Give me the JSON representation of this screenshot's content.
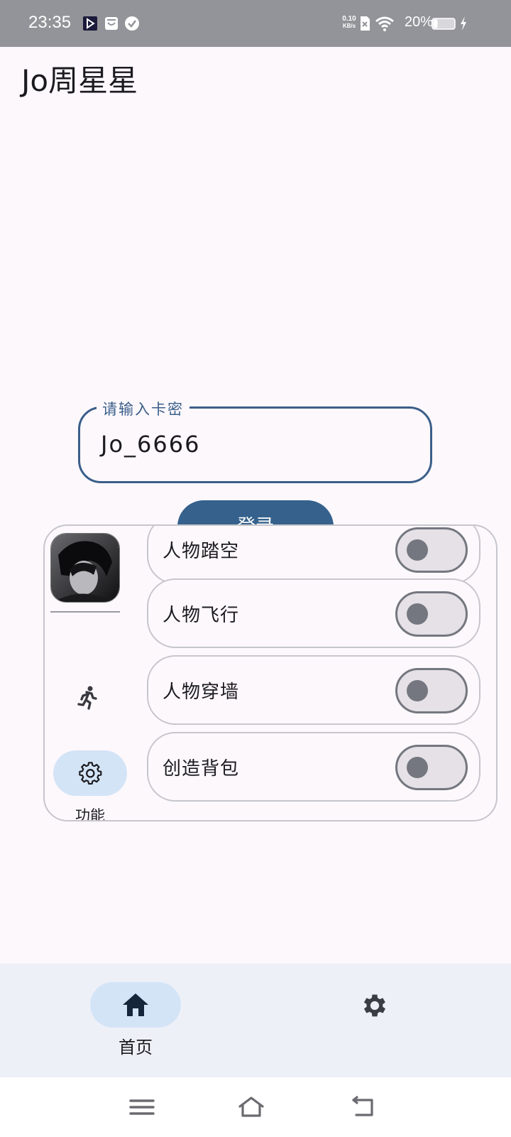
{
  "status_bar": {
    "time": "23:35",
    "network_speed_value": "0.10",
    "network_speed_unit": "KB/s",
    "battery_percent": "20%",
    "icons": [
      "media-icon",
      "store-icon",
      "check-circle-icon",
      "sim-x-icon",
      "wifi-icon",
      "battery-icon",
      "charging-icon"
    ]
  },
  "app": {
    "title": "Jo周星星"
  },
  "login": {
    "key_label": "请输入卡密",
    "key_value": "Jo_6666",
    "button_label": "登录"
  },
  "float_panel": {
    "side_tabs": [
      {
        "icon": "avatar"
      },
      {
        "icon": "run-icon"
      },
      {
        "icon": "gear-icon",
        "label": "功能",
        "selected": true
      }
    ],
    "features": [
      {
        "label": "人物踏空",
        "enabled": false
      },
      {
        "label": "人物飞行",
        "enabled": false
      },
      {
        "label": "人物穿墙",
        "enabled": false
      },
      {
        "label": "创造背包",
        "enabled": false
      }
    ]
  },
  "bottom_nav": {
    "items": [
      {
        "label": "首页",
        "icon": "home-icon",
        "selected": true
      },
      {
        "label": "",
        "icon": "gear-icon",
        "selected": false
      }
    ]
  },
  "system_nav": {
    "icons": [
      "menu-icon",
      "home-outline-icon",
      "back-icon"
    ]
  },
  "colors": {
    "primary": "#35618c",
    "background": "#fdf8fc",
    "nav_background": "#eef0f8",
    "selected_pill": "#d4e4f7",
    "toggle_off_track": "#e5e1e6",
    "toggle_off_border": "#74777f"
  }
}
